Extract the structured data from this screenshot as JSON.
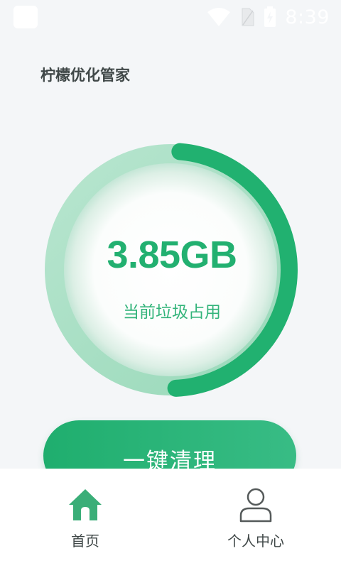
{
  "status_bar": {
    "time": "8:39",
    "icons": [
      "app-notification-icon",
      "wifi-icon",
      "sim-card-icon",
      "battery-charging-icon"
    ]
  },
  "app": {
    "title": "柠檬优化管家"
  },
  "storage": {
    "value_text": "3.85GB",
    "caption": "当前垃圾占用",
    "fill_fraction": 0.48,
    "colors": {
      "arc": "#21b170",
      "ring": "#a7dfc4",
      "text": "#22b070"
    }
  },
  "actions": {
    "clean_label": "一键清理"
  },
  "bottom_nav": {
    "items": [
      {
        "label": "首页",
        "icon": "home-icon",
        "active": true
      },
      {
        "label": "个人中心",
        "icon": "person-icon",
        "active": false
      }
    ],
    "colors": {
      "active": "#3aae78",
      "inactive": "#555a5a"
    }
  }
}
